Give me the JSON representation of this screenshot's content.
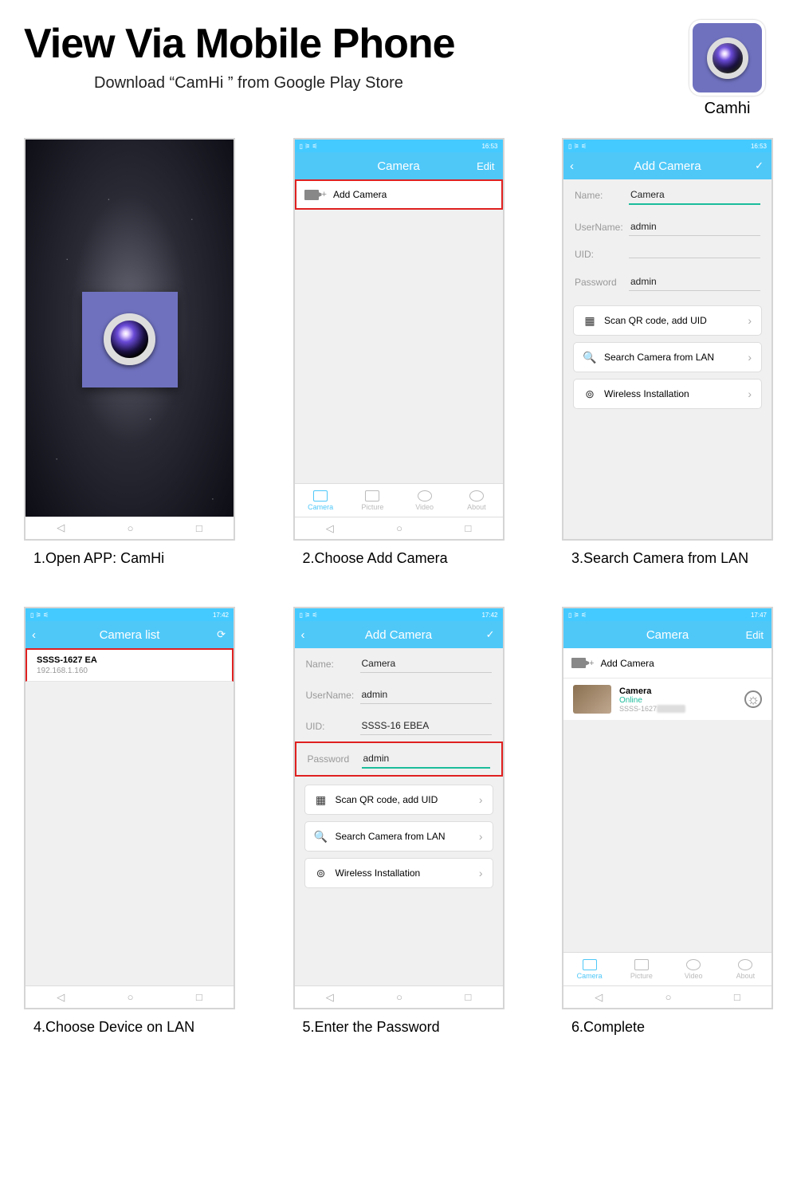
{
  "header": {
    "title": "View Via Mobile Phone",
    "subtitle": "Download “CamHi ” from Google Play Store"
  },
  "app": {
    "name": "Camhi"
  },
  "common": {
    "status_time": "16:53",
    "status_time2": "17:42",
    "status_time3": "17:47",
    "nav_back": "◁",
    "nav_home": "○",
    "nav_recent": "□",
    "tab_camera": "Camera",
    "tab_picture": "Picture",
    "tab_video": "Video",
    "tab_about": "About",
    "edit": "Edit",
    "check": "✓"
  },
  "steps": {
    "s1": {
      "caption": "1.Open APP: CamHi"
    },
    "s2": {
      "caption": "2.Choose Add Camera",
      "screen_title": "Camera",
      "add": "Add Camera"
    },
    "s3": {
      "caption": "3.Search Camera from LAN",
      "screen_title": "Add Camera",
      "name_l": "Name:",
      "name_v": "Camera",
      "user_l": "UserName:",
      "user_v": "admin",
      "uid_l": "UID:",
      "uid_v": "",
      "pwd_l": "Password",
      "pwd_v": "admin",
      "opt1": "Scan QR code, add UID",
      "opt2": "Search Camera from LAN",
      "opt3": "Wireless Installation"
    },
    "s4": {
      "caption": "4.Choose Device on LAN",
      "screen_title": "Camera list",
      "item_title": "SSSS-1627         EA",
      "item_sub": "192.168.1.160"
    },
    "s5": {
      "caption": "5.Enter the Password",
      "screen_title": "Add Camera",
      "name_l": "Name:",
      "name_v": "Camera",
      "user_l": "UserName:",
      "user_v": "admin",
      "uid_l": "UID:",
      "uid_v": "SSSS-16      EBEA",
      "pwd_l": "Password",
      "pwd_v": "admin",
      "opt1": "Scan QR code, add UID",
      "opt2": "Search Camera from LAN",
      "opt3": "Wireless Installation"
    },
    "s6": {
      "caption": "6.Complete",
      "screen_title": "Camera",
      "add": "Add Camera",
      "cam_name": "Camera",
      "cam_status": "Online",
      "cam_uid": "SSSS-1627"
    }
  }
}
